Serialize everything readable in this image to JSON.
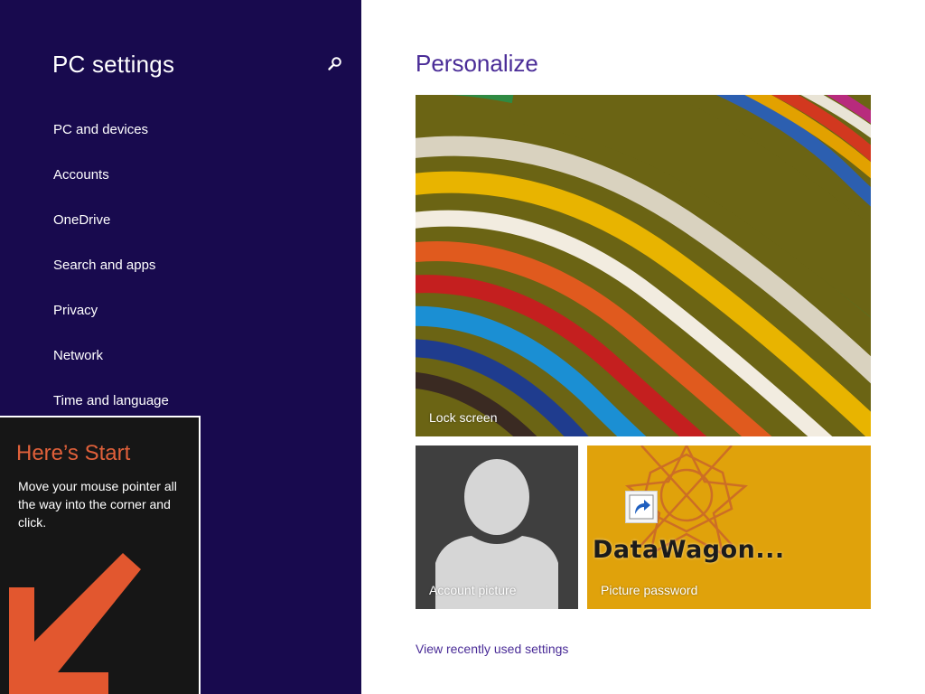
{
  "nav": {
    "title": "PC settings",
    "search_icon": "search-icon",
    "items": [
      {
        "label": "PC and devices"
      },
      {
        "label": "Accounts"
      },
      {
        "label": "OneDrive"
      },
      {
        "label": "Search and apps"
      },
      {
        "label": "Privacy"
      },
      {
        "label": "Network"
      },
      {
        "label": "Time and language"
      }
    ]
  },
  "tip": {
    "title": "Here’s Start",
    "body": "Move your mouse pointer all the way into the corner and click.",
    "arrow_icon": "arrow-down-left-icon"
  },
  "content": {
    "title": "Personalize",
    "tiles": {
      "lock_screen": {
        "label": "Lock screen"
      },
      "account_picture": {
        "label": "Account picture"
      },
      "picture_password": {
        "label": "Picture password",
        "shortcut_text": "DataWagon..."
      }
    },
    "recent_link": "View recently used settings"
  },
  "colors": {
    "nav_background": "#180a4e",
    "accent_purple": "#4a2c97",
    "tip_title": "#e0603a",
    "arrow": "#e2572f",
    "picture_password_tile": "#e0a20b"
  }
}
